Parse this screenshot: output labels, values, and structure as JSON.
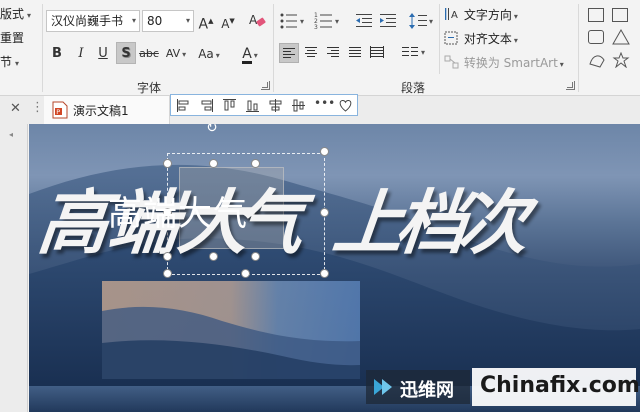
{
  "ribbon": {
    "slides_group": {
      "items": [
        "版式",
        "重置",
        "节"
      ]
    },
    "font_group": {
      "label": "字体",
      "font_name": "汉仪尚巍手书",
      "font_size": "80",
      "increase_size": "A",
      "decrease_size": "A",
      "bold": "B",
      "italic": "I",
      "underline": "U",
      "shadow": "S",
      "strikethrough": "abc",
      "char_spacing": "AV",
      "change_case": "Aa",
      "font_color": "A"
    },
    "paragraph_group": {
      "label": "段落",
      "text_direction": "文字方向",
      "align_text": "对齐文本",
      "convert_smartart": "转换为 SmartArt"
    }
  },
  "tabbar": {
    "doc_title": "演示文稿1"
  },
  "slide": {
    "title_chars": [
      "高",
      "端",
      "大",
      "气",
      "上",
      "档",
      "次"
    ],
    "subtitle": "高端大气"
  },
  "watermark": {
    "brand": "迅维网",
    "site": "Chinafix.com"
  },
  "colors": {
    "ribbon_bg": "#f3f3f3",
    "selection_border": "#89b4de",
    "title_text": "#f4f4f4"
  }
}
